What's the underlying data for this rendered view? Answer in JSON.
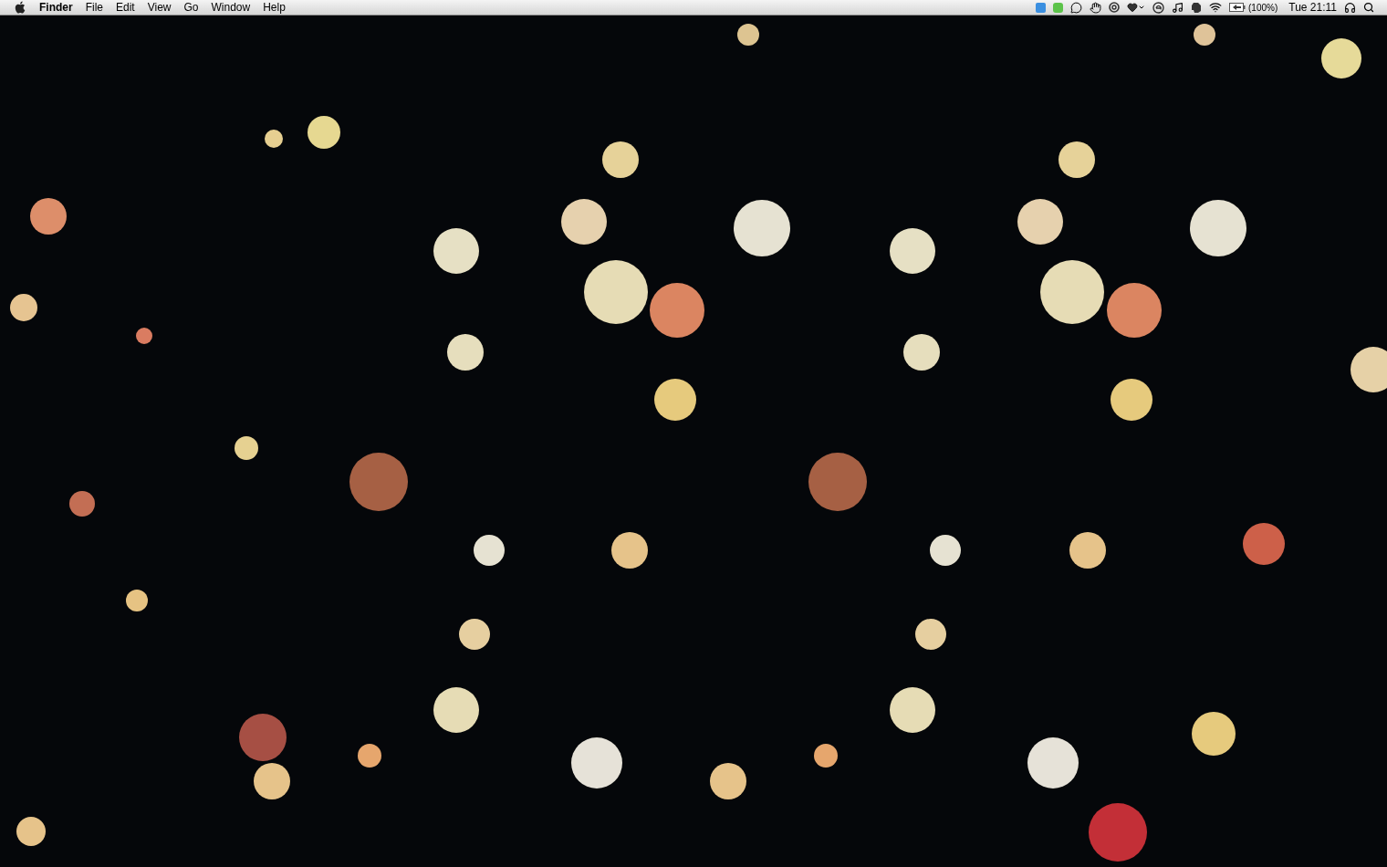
{
  "menu_bar": {
    "menus": [
      {
        "label": "Finder",
        "kind": "app"
      },
      {
        "label": "File",
        "kind": "menu"
      },
      {
        "label": "Edit",
        "kind": "menu"
      },
      {
        "label": "View",
        "kind": "menu"
      },
      {
        "label": "Go",
        "kind": "menu"
      },
      {
        "label": "Window",
        "kind": "menu"
      },
      {
        "label": "Help",
        "kind": "menu"
      }
    ],
    "battery_reading": "(100%)",
    "clock": "Tue 21:11"
  }
}
